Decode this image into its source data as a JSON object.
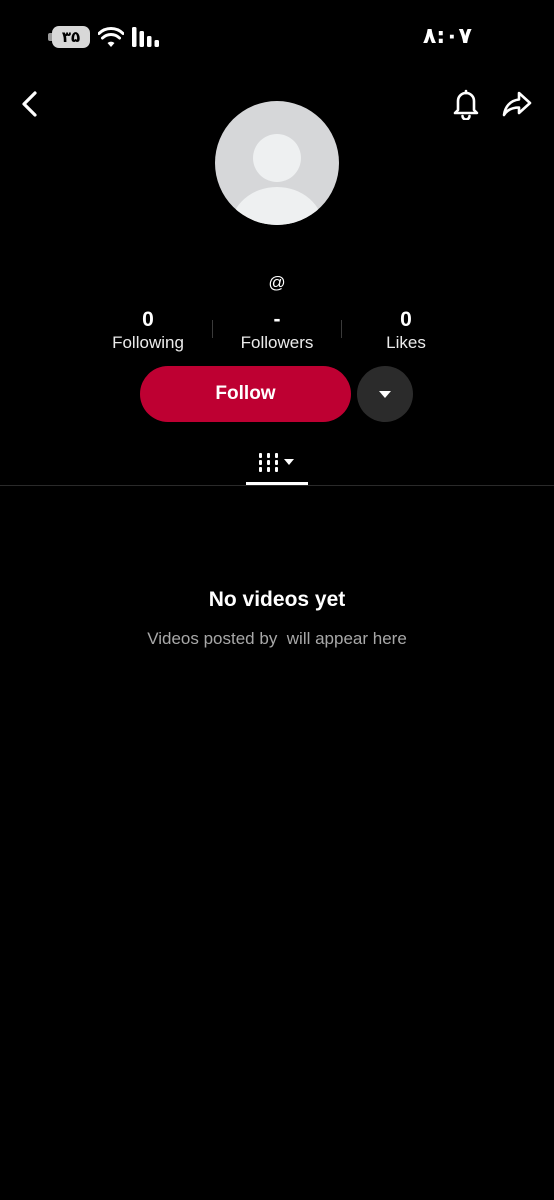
{
  "status_bar": {
    "battery_level": "۳۵",
    "time": "۸:۰۷",
    "icons": [
      "battery-icon",
      "wifi-icon",
      "signal-icon"
    ]
  },
  "nav": {
    "icons": [
      "back-arrow-icon",
      "bell-icon",
      "share-icon"
    ]
  },
  "profile": {
    "avatar_icon": "default-avatar-icon",
    "username": "@"
  },
  "stats": [
    {
      "value": "0",
      "label": "Following"
    },
    {
      "value": "-",
      "label": "Followers"
    },
    {
      "value": "0",
      "label": "Likes"
    }
  ],
  "actions": {
    "follow_label": "Follow",
    "more_icon": "caret-down-icon"
  },
  "tabs": {
    "active_icon": "grid-filter-icon"
  },
  "empty_state": {
    "title": "No videos yet",
    "subtitle": "Videos posted by  will appear here"
  },
  "colors": {
    "background": "#000000",
    "follow_button": "#be0032",
    "secondary_button": "#2b2b2b",
    "muted_text": "#a8a8a8"
  }
}
